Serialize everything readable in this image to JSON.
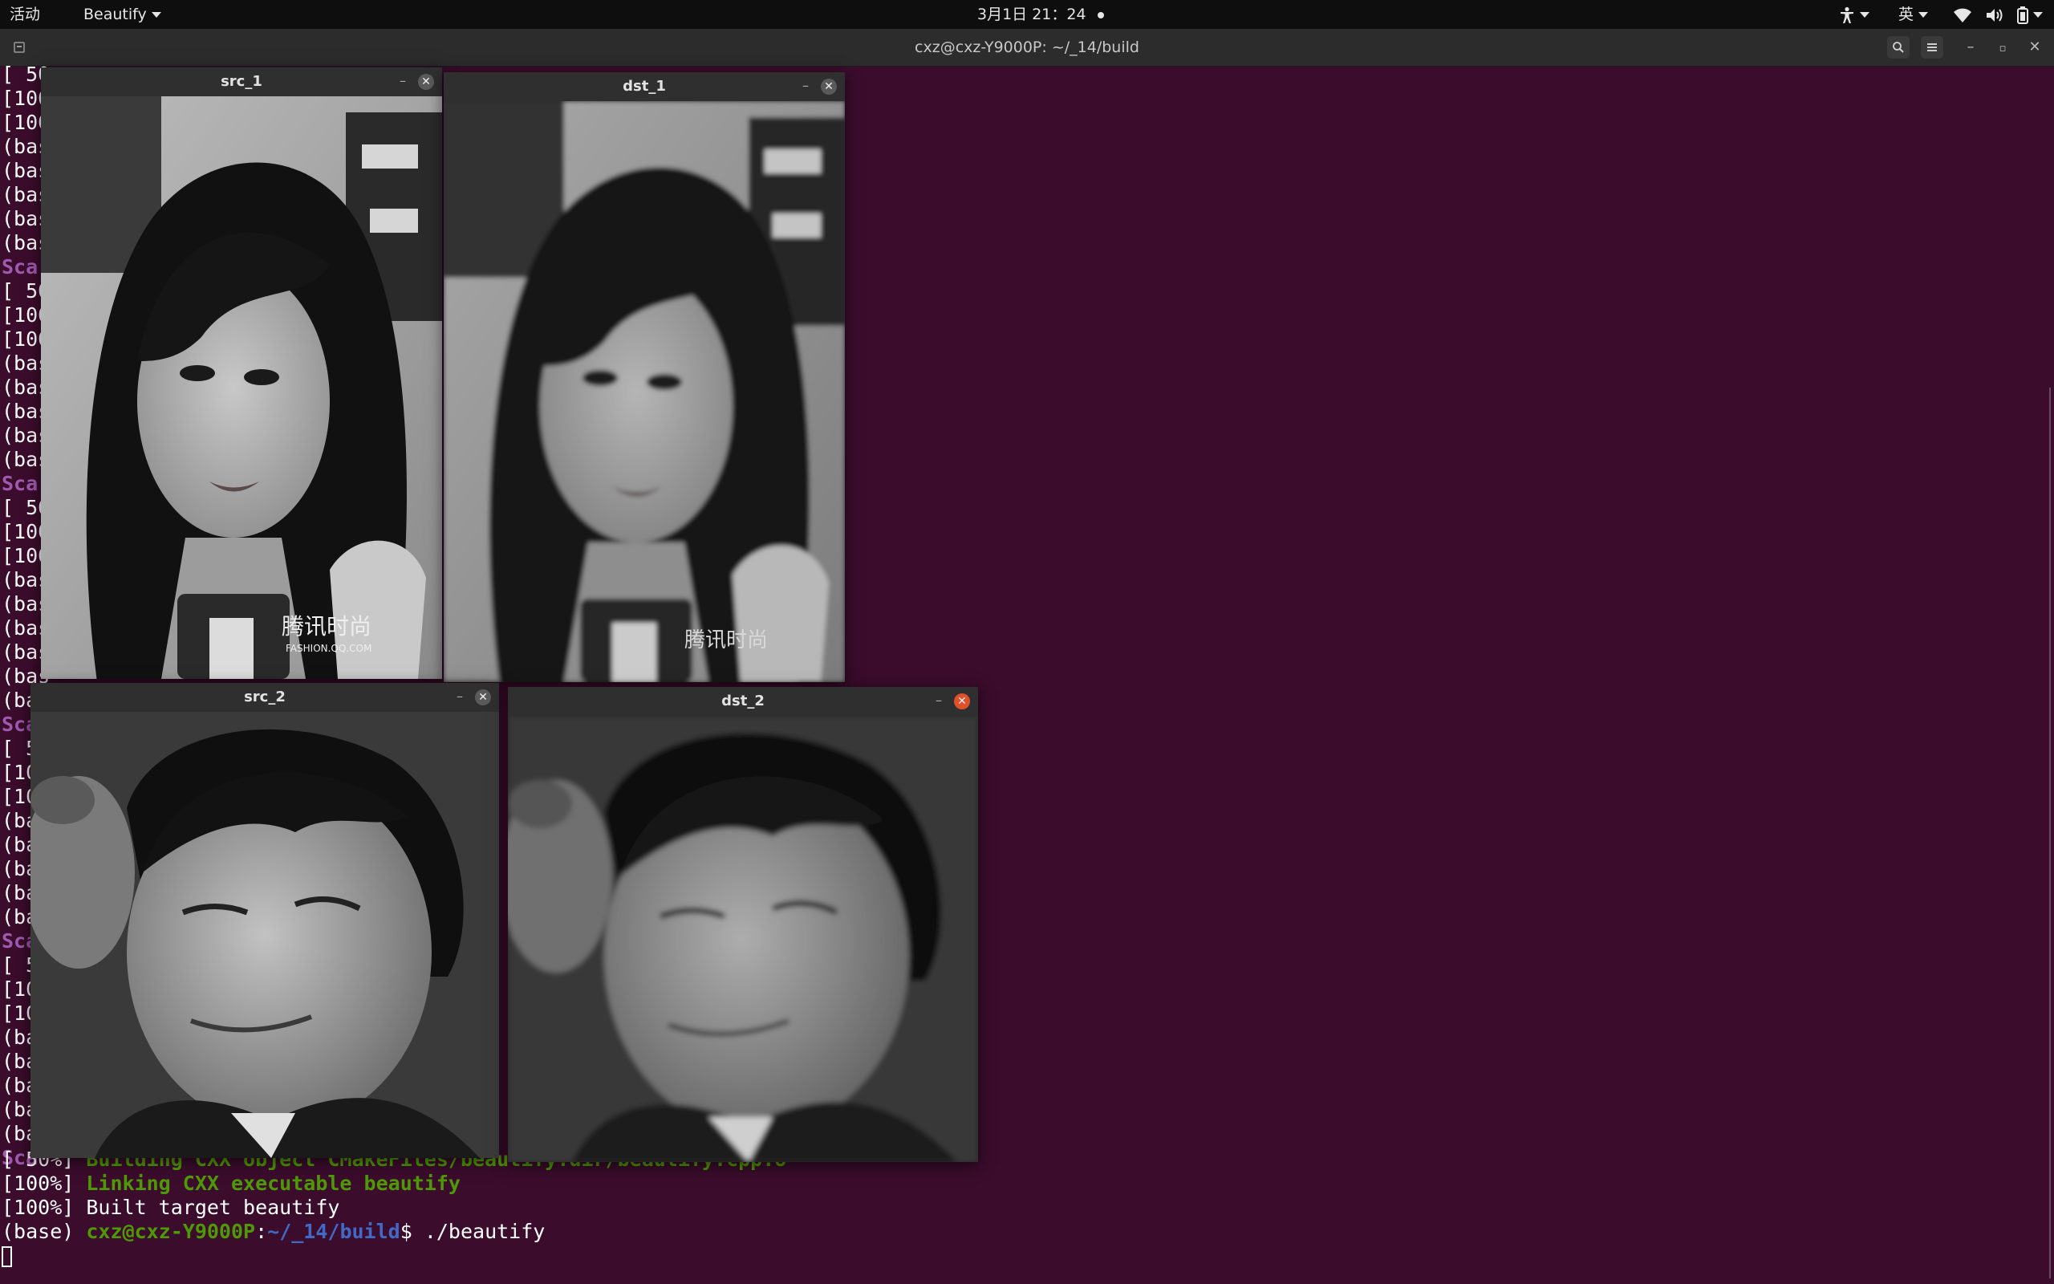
{
  "topbar": {
    "activities": "活动",
    "app_menu": "Beautify",
    "datetime": "3月1日 21：24",
    "input_method": "英"
  },
  "terminal": {
    "title": "cxz@cxz-Y9000P: ~/_14/build",
    "left_column": [
      "[ 50",
      "[100",
      "[100",
      "(bas",
      "(bas",
      "(bas",
      "(bas",
      "(bas",
      "Sca",
      "[ 50",
      "[100",
      "[100",
      "(bas",
      "(bas",
      "(bas",
      "(bas",
      "(bas",
      "Sca",
      "[ 50",
      "[100",
      "[100",
      "(bas",
      "(bas",
      "(bas",
      "(bas",
      "(bas",
      "(base",
      "Sca",
      "[ 5",
      "[10",
      "[10",
      "(ba",
      "(ba",
      "(ba",
      "(ba",
      "(ba",
      "Sca",
      "[ 5",
      "[10",
      "[10",
      "(ba",
      "(ba",
      "(ba",
      "(ba",
      "(ba",
      "Sca"
    ],
    "line_building_prefix": "[ 50%] ",
    "line_building_text": "Building CXX object CMakeFiles/beautify.dir/beautify.cpp.o",
    "line_linking_prefix": "[100%] ",
    "line_linking_text": "Linking CXX executable beautify",
    "line_built": "[100%] Built target beautify",
    "prompt_env": "(base) ",
    "prompt_user": "cxz@cxz-Y9000P",
    "prompt_colon": ":",
    "prompt_path": "~/_14/build",
    "prompt_cmd": "$ ./beautify"
  },
  "windows": {
    "src_1": {
      "title": "src_1",
      "watermark": "腾讯时尚",
      "watermark_sub": "FASHION.QQ.COM"
    },
    "dst_1": {
      "title": "dst_1",
      "watermark": "腾讯时尚"
    },
    "src_2": {
      "title": "src_2"
    },
    "dst_2": {
      "title": "dst_2"
    }
  },
  "icons": {
    "accessibility": "accessibility-icon",
    "wifi": "wifi-icon",
    "volume": "volume-icon",
    "battery": "battery-icon",
    "search": "search-icon",
    "menu": "hamburger-menu-icon"
  },
  "colors": {
    "terminal_bg": "#3b0c2c",
    "green": "#4e9a06",
    "blue": "#4169c8",
    "purple": "#a05ab0",
    "close_active": "#e0502a"
  }
}
